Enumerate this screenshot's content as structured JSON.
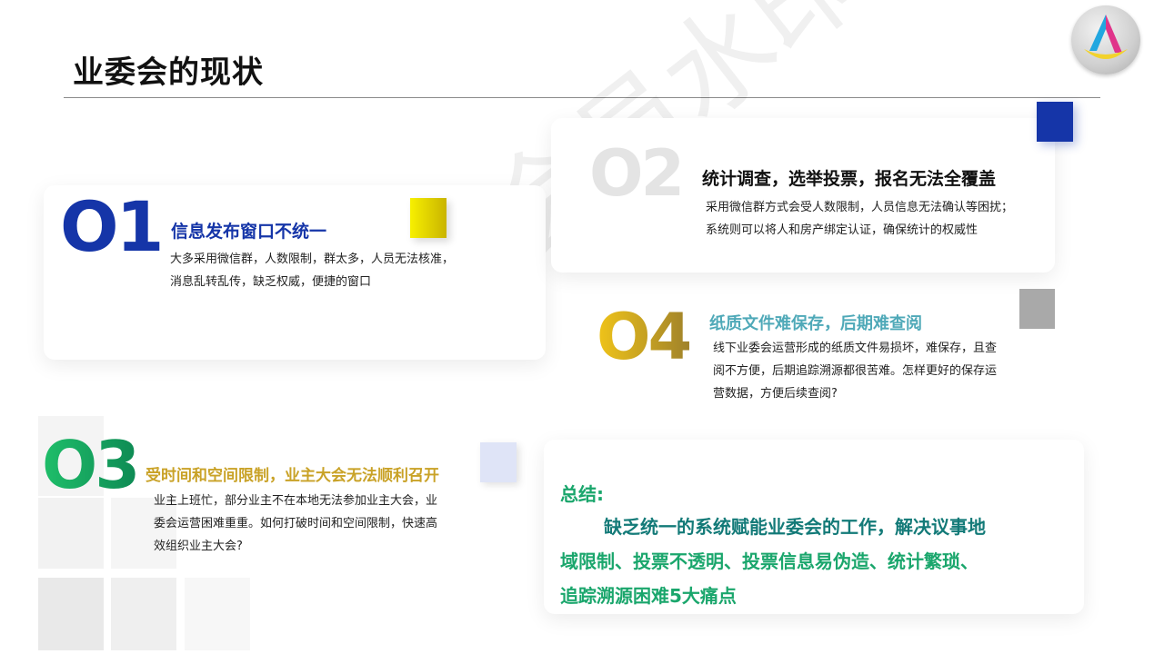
{
  "title": "业委会的现状",
  "watermark": "非会员水印",
  "colors": {
    "blue": "#1535a8",
    "green": "#1aa66c",
    "gold": "#c9a227",
    "teal": "#4fa9b8",
    "summary_teal": "#137a78",
    "summary_green": "#1aa66c"
  },
  "items": [
    {
      "num": "O1",
      "heading": "信息发布窗口不统一",
      "body": [
        "大多采用微信群，人数限制，群太多，人员无法核准，",
        "消息乱转乱传，缺乏权威，便捷的窗口"
      ]
    },
    {
      "num": "O2",
      "heading": "统计调查，选举投票，报名无法全覆盖",
      "body": [
        "采用微信群方式会受人数限制，人员信息无法确认等困扰；",
        "系统则可以将人和房产绑定认证，确保统计的权威性"
      ]
    },
    {
      "num": "O3",
      "heading": "受时间和空间限制，业主大会无法顺利召开",
      "body": [
        "业主上班忙，部分业主不在本地无法参加业主大会，业",
        "委会运营困难重重。如何打破时间和空间限制，快速高",
        "效组织业主大会?"
      ]
    },
    {
      "num": "O4",
      "heading": "纸质文件难保存，后期难查阅",
      "body": [
        "线下业委会运营形成的纸质文件易损坏，难保存，且查",
        "阅不方便，后期追踪溯源都很苦难。怎样更好的保存运",
        "营数据，方便后续查阅?"
      ]
    }
  ],
  "summary": {
    "label": "总结:",
    "lines": [
      "缺乏统一的系统赋能业委会的工作，解决议事地",
      "域限制、投票不透明、投票信息易伪造、统计繁琐、",
      "追踪溯源困难5大痛点"
    ]
  }
}
